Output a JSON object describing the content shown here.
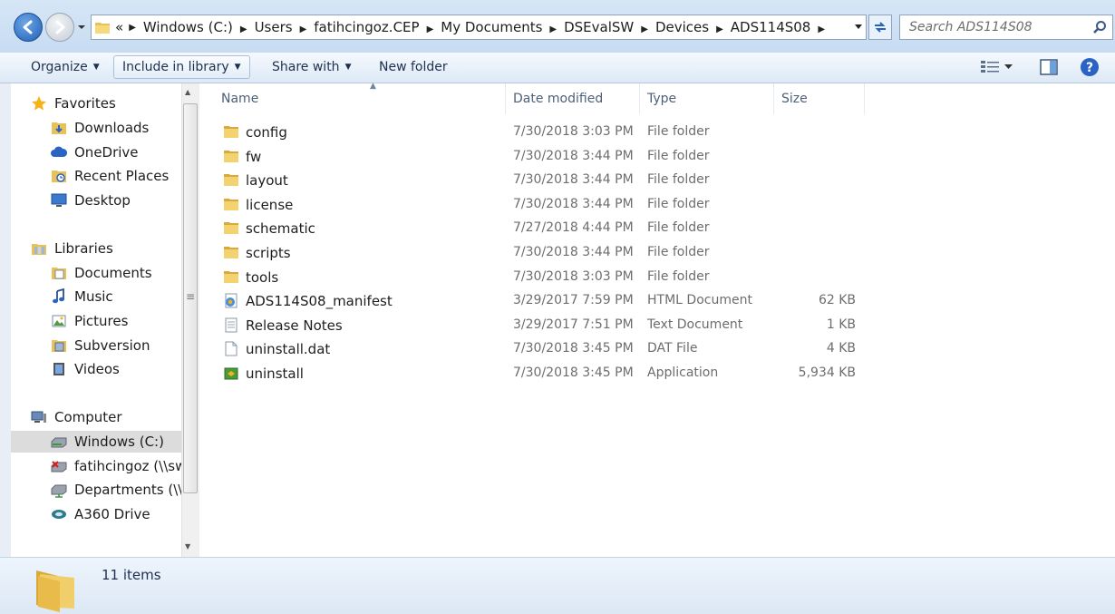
{
  "address_bar": {
    "overflow_chevron": "«",
    "breadcrumbs": [
      "Windows (C:)",
      "Users",
      "fatihcingoz.CEP",
      "My Documents",
      "DSEvalSW",
      "Devices",
      "ADS114S08"
    ],
    "search_placeholder": "Search ADS114S08"
  },
  "command_bar": {
    "organize": "Organize",
    "include_in_library": "Include in library",
    "share_with": "Share with",
    "new_folder": "New folder"
  },
  "navigation": {
    "favorites": {
      "label": "Favorites",
      "items": [
        "Downloads",
        "OneDrive",
        "Recent Places",
        "Desktop"
      ]
    },
    "libraries": {
      "label": "Libraries",
      "items": [
        "Documents",
        "Music",
        "Pictures",
        "Subversion",
        "Videos"
      ]
    },
    "computer": {
      "label": "Computer",
      "items": [
        "Windows (C:)",
        "fatihcingoz (\\\\swc-u",
        "Departments (\\\\SW",
        "A360 Drive"
      ]
    },
    "selected": "Windows (C:)"
  },
  "columns": {
    "name": "Name",
    "date": "Date modified",
    "type": "Type",
    "size": "Size"
  },
  "files": [
    {
      "name": "config",
      "date": "7/30/2018 3:03 PM",
      "type": "File folder",
      "size": "",
      "icon": "folder-icon"
    },
    {
      "name": "fw",
      "date": "7/30/2018 3:44 PM",
      "type": "File folder",
      "size": "",
      "icon": "folder-icon"
    },
    {
      "name": "layout",
      "date": "7/30/2018 3:44 PM",
      "type": "File folder",
      "size": "",
      "icon": "folder-icon"
    },
    {
      "name": "license",
      "date": "7/30/2018 3:44 PM",
      "type": "File folder",
      "size": "",
      "icon": "folder-icon"
    },
    {
      "name": "schematic",
      "date": "7/27/2018 4:44 PM",
      "type": "File folder",
      "size": "",
      "icon": "folder-icon"
    },
    {
      "name": "scripts",
      "date": "7/30/2018 3:44 PM",
      "type": "File folder",
      "size": "",
      "icon": "folder-icon"
    },
    {
      "name": "tools",
      "date": "7/30/2018 3:03 PM",
      "type": "File folder",
      "size": "",
      "icon": "folder-icon"
    },
    {
      "name": "ADS114S08_manifest",
      "date": "3/29/2017 7:59 PM",
      "type": "HTML Document",
      "size": "62 KB",
      "icon": "html-document-icon"
    },
    {
      "name": "Release Notes",
      "date": "3/29/2017 7:51 PM",
      "type": "Text Document",
      "size": "1 KB",
      "icon": "text-document-icon"
    },
    {
      "name": "uninstall.dat",
      "date": "7/30/2018 3:45 PM",
      "type": "DAT File",
      "size": "4 KB",
      "icon": "dat-file-icon"
    },
    {
      "name": "uninstall",
      "date": "7/30/2018 3:45 PM",
      "type": "Application",
      "size": "5,934 KB",
      "icon": "application-icon"
    }
  ],
  "status": {
    "item_count": "11 items"
  }
}
